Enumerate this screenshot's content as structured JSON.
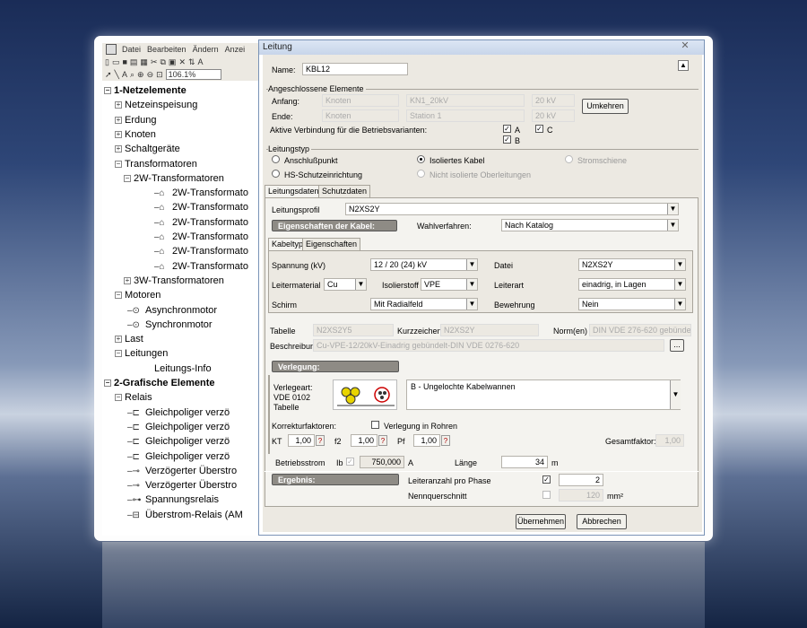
{
  "app": {
    "menu": [
      "Datei",
      "Bearbeiten",
      "Ändern",
      "Anzei"
    ],
    "zoom": "106.1%"
  },
  "tree": [
    {
      "label": "1-Netzelemente",
      "bold": true,
      "exp": "−"
    },
    {
      "label": "Netzeinspeisung",
      "exp": "+"
    },
    {
      "label": "Erdung",
      "exp": "+"
    },
    {
      "label": "Knoten",
      "exp": "+"
    },
    {
      "label": "Schaltgeräte",
      "exp": "+"
    },
    {
      "label": "Transformatoren",
      "exp": "−"
    },
    {
      "label": "2W-Transformatoren",
      "exp": "−"
    },
    {
      "label": "2W-Transformato"
    },
    {
      "label": "2W-Transformato"
    },
    {
      "label": "2W-Transformato"
    },
    {
      "label": "2W-Transformato"
    },
    {
      "label": "2W-Transformato"
    },
    {
      "label": "2W-Transformato"
    },
    {
      "label": "3W-Transformatoren",
      "exp": "+"
    },
    {
      "label": "Motoren",
      "exp": "−"
    },
    {
      "label": "Asynchronmotor"
    },
    {
      "label": "Synchronmotor"
    },
    {
      "label": "Last",
      "exp": "+"
    },
    {
      "label": "Leitungen",
      "exp": "−"
    },
    {
      "label": "Leitungs-Info"
    },
    {
      "label": "2-Grafische Elemente",
      "bold": true,
      "exp": "−"
    },
    {
      "label": "Relais",
      "exp": "−"
    },
    {
      "label": "Gleichpoliger verzö"
    },
    {
      "label": "Gleichpoliger verzö"
    },
    {
      "label": "Gleichpoliger verzö"
    },
    {
      "label": "Gleichpoliger verzö"
    },
    {
      "label": "Verzögerter Überstro"
    },
    {
      "label": "Verzögerter Überstro"
    },
    {
      "label": "Spannungsrelais"
    },
    {
      "label": "Überstrom-Relais (AM"
    }
  ],
  "dialog": {
    "title": "Leitung",
    "name_label": "Name:",
    "name": "KBL12",
    "connected": {
      "title": "Angeschlossene Elemente",
      "start_label": "Anfang:",
      "end_label": "Ende:",
      "start": [
        "Knoten",
        "KN1_20kV",
        "20 kV"
      ],
      "end": [
        "Knoten",
        "Station 1",
        "20 kV"
      ],
      "swap": "Umkehren",
      "active_label": "Aktive Verbindung für die Betriebsvarianten:",
      "variants": [
        "A",
        "C",
        "B"
      ]
    },
    "type": {
      "title": "Leitungstyp",
      "options": [
        "Anschlußpunkt",
        "Isoliertes Kabel",
        "Stromschiene",
        "HS-Schutzeinrichtung",
        "Nicht isolierte Oberleitungen"
      ]
    },
    "tabs": [
      "Leitungsdaten",
      "Schutzdaten"
    ],
    "profile_label": "Leitungsprofil",
    "profile": "N2XS2Y",
    "cable_props": "Eigenschaften der Kabel:",
    "method_label": "Wahlverfahren:",
    "method": "Nach Katalog",
    "subtabs": [
      "Kabeltyp",
      "Eigenschaften"
    ],
    "cable": {
      "voltage_label": "Spannung (kV)",
      "voltage": "12 / 20 (24) kV",
      "file_label": "Datei",
      "file": "N2XS2Y",
      "material_label": "Leitermaterial",
      "material": "Cu",
      "insulation_label": "Isolierstoff",
      "insulation": "VPE",
      "conductor_label": "Leiterart",
      "conductor": "einadrig, in Lagen",
      "shield_label": "Schirm",
      "shield": "Mit Radialfeld",
      "armour_label": "Bewehrung",
      "armour": "Nein"
    },
    "table_label": "Tabelle",
    "table": "N2XS2Y5",
    "short_label": "Kurzzeichen",
    "short": "N2XS2Y",
    "norm_label": "Norm(en)",
    "norm": "DIN VDE 276-620  gebünde",
    "desc_label": "Beschreibung",
    "desc": "Cu-VPE-12/20kV-Einadrig gebündelt-DIN VDE 0276-620",
    "dots": "...",
    "laying": {
      "head": "Verlegung:",
      "type_label": "Verlegeart:",
      "norm": "VDE 0102",
      "table": "Tabelle",
      "value": "B - Ungelochte Kabelwannen",
      "corr_label": "Korrekturfaktoren:",
      "pipe_label": "Verlegung in Rohren",
      "kt_label": "KT",
      "kt": "1,00",
      "f2_label": "f2",
      "f2": "1,00",
      "pf_label": "Pf",
      "pf": "1,00",
      "q": "?",
      "total_label": "Gesamtfaktor:",
      "total": "1,00"
    },
    "current_label": "Betriebsstrom",
    "ib": "Ib",
    "current": "750,000",
    "current_unit": "A",
    "length_label": "Länge",
    "length": "34",
    "length_unit": "m",
    "result": {
      "head": "Ergebnis:",
      "cond_label": "Leiteranzahl pro Phase",
      "cond": "2",
      "cs_label": "Nennquerschnitt",
      "cs": "120",
      "cs_unit": "mm²"
    },
    "ok": "Übernehmen",
    "cancel": "Abbrechen"
  }
}
